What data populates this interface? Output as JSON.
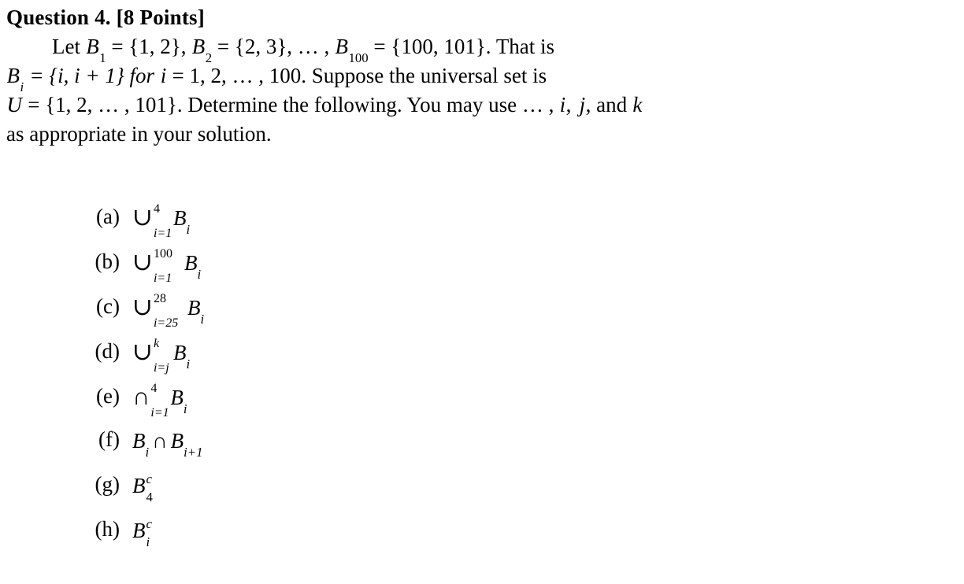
{
  "document": {
    "background_color": "#ffffff",
    "text_color": "#000000",
    "question_title": "Question 4. [8 Points]",
    "prose": {
      "line1_indent": "Let",
      "line1_rest_1": "= {1, 2},",
      "line1_rest_2": "= {2, 3}, … ,",
      "line1_rest_3": "= {100, 101}. That is",
      "line2_a": "= {i, i + 1} for",
      "line2_b": "= 1, 2, … , 100. Suppose the universal set is",
      "line3_a": "= {1, 2, … , 101}. Determine the following. You may use … ,",
      "line3_b": ", and",
      "line4": "as appropriate in your solution."
    },
    "symbols": {
      "B": "B",
      "U": "U",
      "i": "i",
      "j": "j",
      "k": "k",
      "union": "∪",
      "intersection": "∩",
      "equals": "=",
      "plus": "+",
      "brace_open": "{",
      "brace_close": "}",
      "ellipsis": "…",
      "superscript_c": "c"
    },
    "subscripts": {
      "one": "1",
      "two": "2",
      "hundred": "100",
      "i": "i",
      "four": "4"
    },
    "list": {
      "items": [
        {
          "label": "(a)",
          "operator": "∪",
          "upper": "4",
          "lower": "i=1",
          "base": "B",
          "base_sub": "i",
          "base_sup": "",
          "kind": "bigop"
        },
        {
          "label": "(b)",
          "operator": "∪",
          "upper": "100",
          "lower": "i=1",
          "base": "B",
          "base_sub": "i",
          "base_sup": "",
          "kind": "bigop"
        },
        {
          "label": "(c)",
          "operator": "∪",
          "upper": "28",
          "lower": "i=25",
          "base": "B",
          "base_sub": "i",
          "base_sup": "",
          "kind": "bigop"
        },
        {
          "label": "(d)",
          "operator": "∪",
          "upper": "k",
          "lower": "i=j",
          "base": "B",
          "base_sub": "i",
          "base_sup": "",
          "kind": "bigop"
        },
        {
          "label": "(e)",
          "operator": "∩",
          "upper": "4",
          "lower": "i=1",
          "base": "B",
          "base_sub": "i",
          "base_sup": "",
          "kind": "bigop"
        },
        {
          "label": "(f)",
          "operator": "∩",
          "upper": "",
          "lower": "",
          "base": "B",
          "base_sub": "i",
          "base2": "B",
          "base2_sub": "i+1",
          "kind": "binary"
        },
        {
          "label": "(g)",
          "operator": "",
          "upper": "",
          "lower": "",
          "base": "B",
          "base_sub": "4",
          "base_sup": "c",
          "kind": "complement"
        },
        {
          "label": "(h)",
          "operator": "",
          "upper": "",
          "lower": "",
          "base": "B",
          "base_sub": "i",
          "base_sup": "c",
          "kind": "complement"
        }
      ]
    }
  }
}
